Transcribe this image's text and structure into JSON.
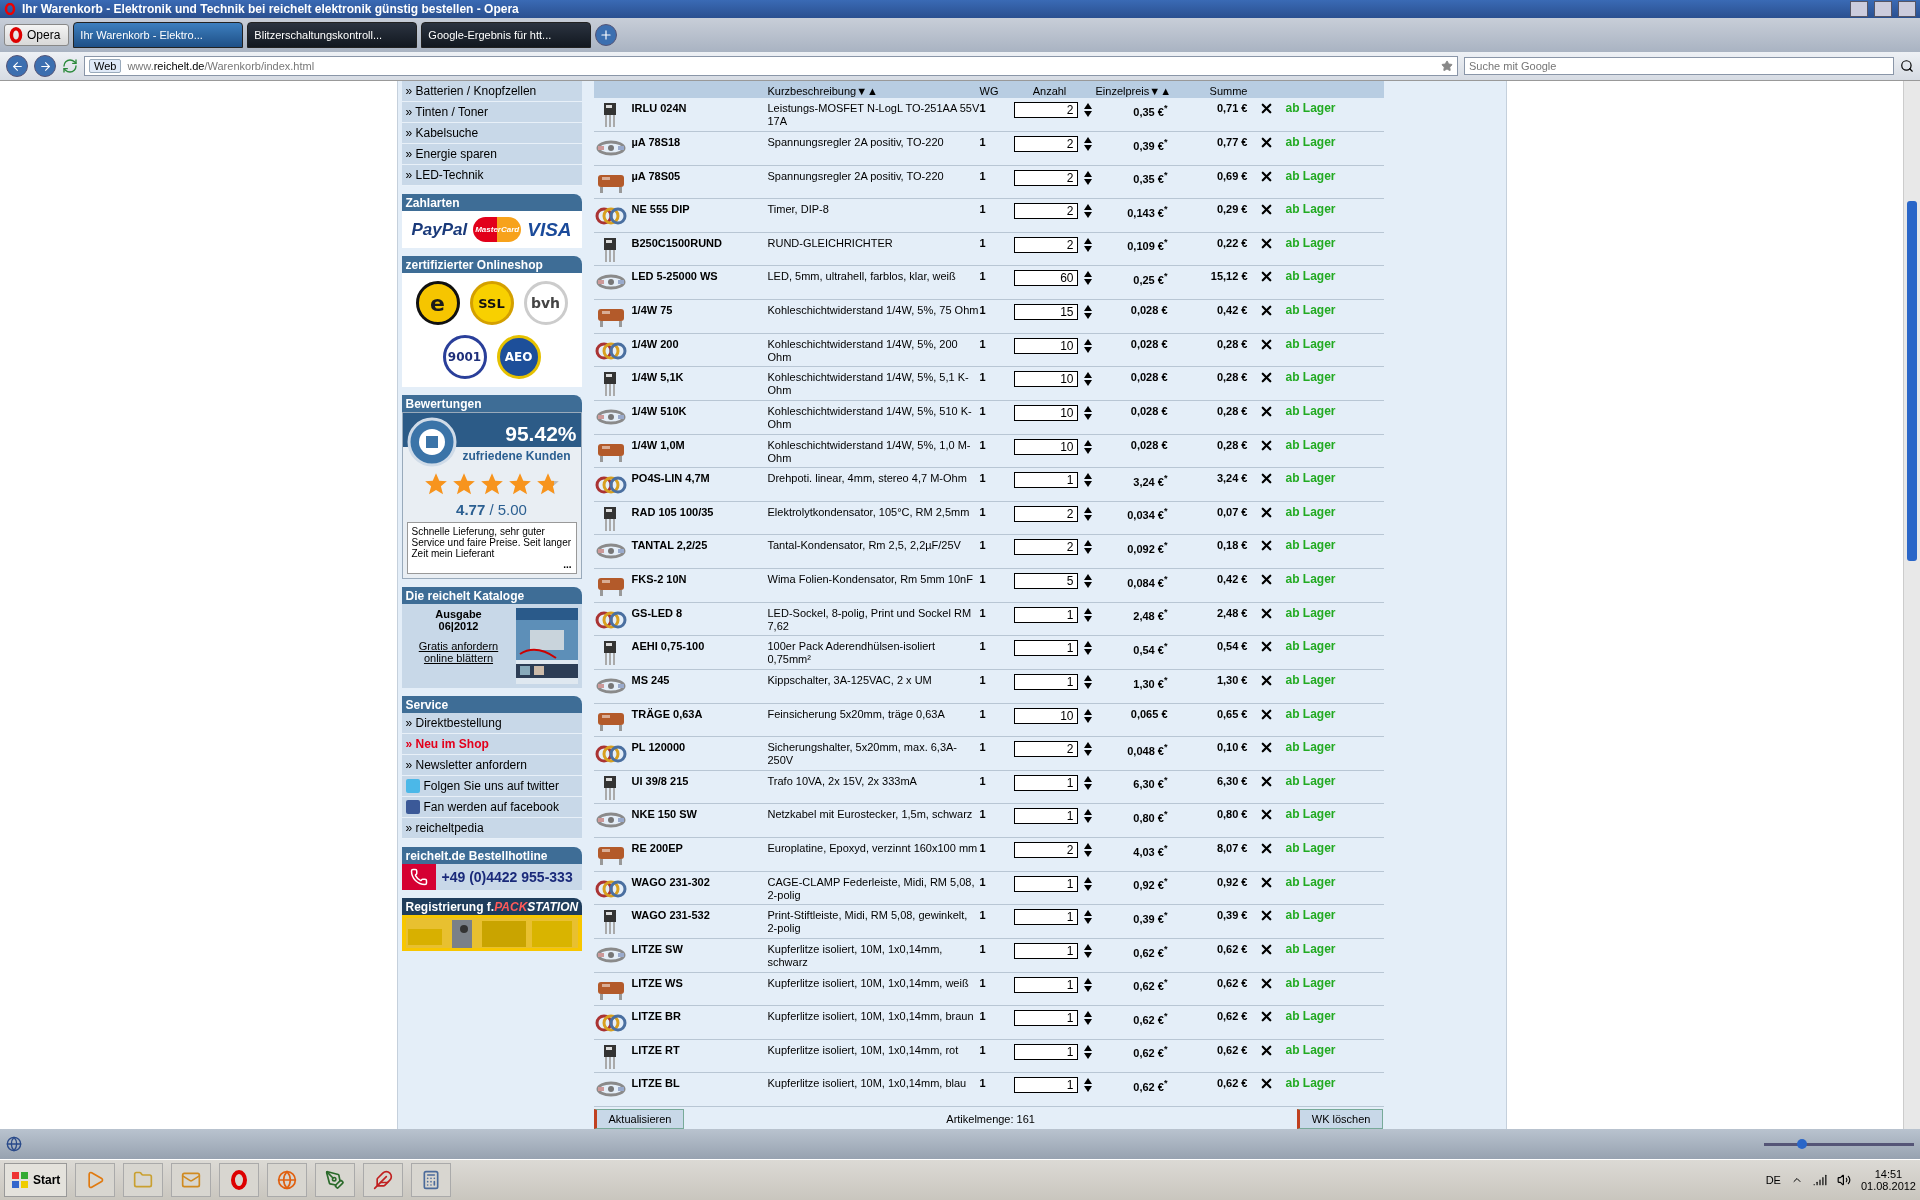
{
  "window": {
    "title": "Ihr Warenkorb - Elektronik und Technik bei reichelt elektronik günstig bestellen - Opera"
  },
  "browser": {
    "menu_button": "Opera",
    "tabs": [
      {
        "label": "Ihr Warenkorb - Elektro...",
        "selected": true
      },
      {
        "label": "Blitzerschaltungskontroll...",
        "selected": false
      },
      {
        "label": "Google-Ergebnis für htt...",
        "selected": false
      }
    ],
    "address_badge": "Web",
    "address_host": "www.",
    "address_domain": "reichelt.de",
    "address_path": "/Warenkorb/index.html",
    "search_placeholder": "Suche mit Google"
  },
  "sidebar": {
    "categories": [
      "» Batterien / Knopfzellen",
      "» Tinten / Toner",
      "» Kabelsuche",
      "» Energie sparen",
      "» LED-Technik"
    ],
    "payment": {
      "title": "Zahlarten",
      "logos": [
        "PayPal",
        "MasterCard",
        "VISA"
      ]
    },
    "certified": {
      "title": "zertifizierter Onlineshop",
      "badges": [
        {
          "kind": "trusted",
          "text": "e"
        },
        {
          "kind": "ssl",
          "text": "SSL"
        },
        {
          "kind": "bvh",
          "text": "bvh"
        },
        {
          "kind": "iso",
          "text": "9001"
        },
        {
          "kind": "aeo",
          "text": "AEO"
        }
      ]
    },
    "rating": {
      "title": "Bewertungen",
      "percent": "95.42%",
      "caption": "zufriedene Kunden",
      "stars": 4.77,
      "score": "4.77",
      "max": "/ 5.00",
      "review": "Schnelle Lieferung, sehr guter Service und faire Preise. Seit langer Zeit mein Lieferant",
      "more": "..."
    },
    "catalog": {
      "title": "Die reichelt Kataloge",
      "edition": "Ausgabe 06|2012",
      "links": [
        "Gratis anfordern",
        "online blättern"
      ]
    },
    "service": {
      "title": "Service",
      "items": [
        {
          "kind": "link",
          "label": "» Direktbestellung",
          "highlight": false
        },
        {
          "kind": "link",
          "label": "» Neu im Shop",
          "highlight": true
        },
        {
          "kind": "link",
          "label": "» Newsletter anfordern",
          "highlight": false
        },
        {
          "kind": "twitter",
          "label": "Folgen Sie uns auf twitter",
          "highlight": false
        },
        {
          "kind": "facebook",
          "label": "Fan werden auf facebook",
          "highlight": false
        },
        {
          "kind": "link",
          "label": "» reicheltpedia",
          "highlight": false
        }
      ]
    },
    "hotline": {
      "title": "reichelt.de Bestellhotline",
      "phone": "+49 (0)4422 955-333"
    },
    "packstation": {
      "title": "Registrierung f. ",
      "brand_red": "PACK",
      "brand_white": "STATION"
    }
  },
  "cart": {
    "columns": [
      "Kurzbeschreibung▼▲",
      "WG",
      "Anzahl",
      "Einzelpreis▼▲",
      "Summe"
    ],
    "rows": [
      {
        "article": "IRLU 024N",
        "description": "Leistungs-MOSFET N-LogL TO-251AA 55V 17A",
        "wg": "1",
        "quantity": "2",
        "price": "0,35 €$^{*}$",
        "sum": "0,71 €",
        "stock": "ab Lager"
      },
      {
        "article": "µA 78S18",
        "description": "Spannungsregler 2A positiv, TO-220",
        "wg": "1",
        "quantity": "2",
        "price": "0,39 €$^{*}$",
        "sum": "0,77 €",
        "stock": "ab Lager"
      },
      {
        "article": "µA 78S05",
        "description": "Spannungsregler 2A positiv, TO-220",
        "wg": "1",
        "quantity": "2",
        "price": "0,35 €$^{*}$",
        "sum": "0,69 €",
        "stock": "ab Lager"
      },
      {
        "article": "NE 555 DIP",
        "description": "Timer, DIP-8",
        "wg": "1",
        "quantity": "2",
        "price": "0,143 €$^{*}$",
        "sum": "0,29 €",
        "stock": "ab Lager"
      },
      {
        "article": "B250C1500RUND",
        "description": "RUND-GLEICHRICHTER",
        "wg": "1",
        "quantity": "2",
        "price": "0,109 €$^{*}$",
        "sum": "0,22 €",
        "stock": "ab Lager"
      },
      {
        "article": "LED 5-25000 WS",
        "description": "LED, 5mm, ultrahell, farblos, klar, weiß",
        "wg": "1",
        "quantity": "60",
        "price": "0,25 €$^{*}$",
        "sum": "15,12 €",
        "stock": "ab Lager"
      },
      {
        "article": "1/4W 75",
        "description": "Kohleschichtwiderstand 1/4W, 5%, 75 Ohm",
        "wg": "1",
        "quantity": "15",
        "price": "0,028 €",
        "sum": "0,42 €",
        "stock": "ab Lager"
      },
      {
        "article": "1/4W 200",
        "description": "Kohleschichtwiderstand 1/4W, 5%, 200 Ohm",
        "wg": "1",
        "quantity": "10",
        "price": "0,028 €",
        "sum": "0,28 €",
        "stock": "ab Lager"
      },
      {
        "article": "1/4W 5,1K",
        "description": "Kohleschichtwiderstand 1/4W, 5%, 5,1 K-Ohm",
        "wg": "1",
        "quantity": "10",
        "price": "0,028 €",
        "sum": "0,28 €",
        "stock": "ab Lager"
      },
      {
        "article": "1/4W 510K",
        "description": "Kohleschichtwiderstand 1/4W, 5%, 510 K-Ohm",
        "wg": "1",
        "quantity": "10",
        "price": "0,028 €",
        "sum": "0,28 €",
        "stock": "ab Lager"
      },
      {
        "article": "1/4W 1,0M",
        "description": "Kohleschichtwiderstand 1/4W, 5%, 1,0 M-Ohm",
        "wg": "1",
        "quantity": "10",
        "price": "0,028 €",
        "sum": "0,28 €",
        "stock": "ab Lager"
      },
      {
        "article": "PO4S-LIN 4,7M",
        "description": "Drehpoti. linear, 4mm, stereo 4,7 M-Ohm",
        "wg": "1",
        "quantity": "1",
        "price": "3,24 €$^{*}$",
        "sum": "3,24 €",
        "stock": "ab Lager"
      },
      {
        "article": "RAD 105 100/35",
        "description": "Elektrolytkondensator, 105°C, RM 2,5mm",
        "wg": "1",
        "quantity": "2",
        "price": "0,034 €$^{*}$",
        "sum": "0,07 €",
        "stock": "ab Lager"
      },
      {
        "article": "TANTAL 2,2/25",
        "description": "Tantal-Kondensator, Rm 2,5, 2,2µF/25V",
        "wg": "1",
        "quantity": "2",
        "price": "0,092 €$^{*}$",
        "sum": "0,18 €",
        "stock": "ab Lager"
      },
      {
        "article": "FKS-2 10N",
        "description": "Wima Folien-Kondensator, Rm 5mm 10nF",
        "wg": "1",
        "quantity": "5",
        "price": "0,084 €$^{*}$",
        "sum": "0,42 €",
        "stock": "ab Lager"
      },
      {
        "article": "GS-LED 8",
        "description": "LED-Sockel, 8-polig, Print und Sockel RM 7,62",
        "wg": "1",
        "quantity": "1",
        "price": "2,48 €$^{*}$",
        "sum": "2,48 €",
        "stock": "ab Lager"
      },
      {
        "article": "AEHI 0,75-100",
        "description": "100er Pack Aderendhülsen-isoliert 0,75mm²",
        "wg": "1",
        "quantity": "1",
        "price": "0,54 €$^{*}$",
        "sum": "0,54 €",
        "stock": "ab Lager"
      },
      {
        "article": "MS 245",
        "description": "Kippschalter, 3A-125VAC, 2 x UM",
        "wg": "1",
        "quantity": "1",
        "price": "1,30 €$^{*}$",
        "sum": "1,30 €",
        "stock": "ab Lager"
      },
      {
        "article": "TRÄGE 0,63A",
        "description": "Feinsicherung 5x20mm, träge 0,63A",
        "wg": "1",
        "quantity": "10",
        "price": "0,065 €",
        "sum": "0,65 €",
        "stock": "ab Lager"
      },
      {
        "article": "PL 120000",
        "description": "Sicherungshalter, 5x20mm, max. 6,3A-250V",
        "wg": "1",
        "quantity": "2",
        "price": "0,048 €$^{*}$",
        "sum": "0,10 €",
        "stock": "ab Lager"
      },
      {
        "article": "UI 39/8 215",
        "description": "Trafo 10VA, 2x 15V, 2x 333mA",
        "wg": "1",
        "quantity": "1",
        "price": "6,30 €$^{*}$",
        "sum": "6,30 €",
        "stock": "ab Lager"
      },
      {
        "article": "NKE 150 SW",
        "description": "Netzkabel mit Eurostecker, 1,5m, schwarz",
        "wg": "1",
        "quantity": "1",
        "price": "0,80 €$^{*}$",
        "sum": "0,80 €",
        "stock": "ab Lager"
      },
      {
        "article": "RE 200EP",
        "description": "Europlatine, Epoxyd, verzinnt 160x100 mm",
        "wg": "1",
        "quantity": "2",
        "price": "4,03 €$^{*}$",
        "sum": "8,07 €",
        "stock": "ab Lager"
      },
      {
        "article": "WAGO 231-302",
        "description": "CAGE-CLAMP Federleiste, Midi, RM 5,08, 2-polig",
        "wg": "1",
        "quantity": "1",
        "price": "0,92 €$^{*}$",
        "sum": "0,92 €",
        "stock": "ab Lager"
      },
      {
        "article": "WAGO 231-532",
        "description": "Print-Stiftleiste, Midi, RM 5,08, gewinkelt, 2-polig",
        "wg": "1",
        "quantity": "1",
        "price": "0,39 €$^{*}$",
        "sum": "0,39 €",
        "stock": "ab Lager"
      },
      {
        "article": "LITZE SW",
        "description": "Kupferlitze isoliert, 10M, 1x0,14mm, schwarz",
        "wg": "1",
        "quantity": "1",
        "price": "0,62 €$^{*}$",
        "sum": "0,62 €",
        "stock": "ab Lager"
      },
      {
        "article": "LITZE WS",
        "description": "Kupferlitze isoliert, 10M, 1x0,14mm, weiß",
        "wg": "1",
        "quantity": "1",
        "price": "0,62 €$^{*}$",
        "sum": "0,62 €",
        "stock": "ab Lager"
      },
      {
        "article": "LITZE BR",
        "description": "Kupferlitze isoliert, 10M, 1x0,14mm, braun",
        "wg": "1",
        "quantity": "1",
        "price": "0,62 €$^{*}$",
        "sum": "0,62 €",
        "stock": "ab Lager"
      },
      {
        "article": "LITZE RT",
        "description": "Kupferlitze isoliert, 10M, 1x0,14mm, rot",
        "wg": "1",
        "quantity": "1",
        "price": "0,62 €$^{*}$",
        "sum": "0,62 €",
        "stock": "ab Lager"
      },
      {
        "article": "LITZE BL",
        "description": "Kupferlitze isoliert, 10M, 1x0,14mm, blau",
        "wg": "1",
        "quantity": "1",
        "price": "0,62 €$^{*}$",
        "sum": "0,62 €",
        "stock": "ab Lager"
      }
    ],
    "update_button": "Aktualisieren",
    "item_count": "Artikelmenge: 161",
    "clear_button": "WK löschen"
  },
  "status_bar": {
    "zoom": {
      "level": 0.25
    }
  },
  "taskbar": {
    "start": "Start",
    "language": "DE",
    "time": "14:51",
    "date": "01.08.2012"
  }
}
